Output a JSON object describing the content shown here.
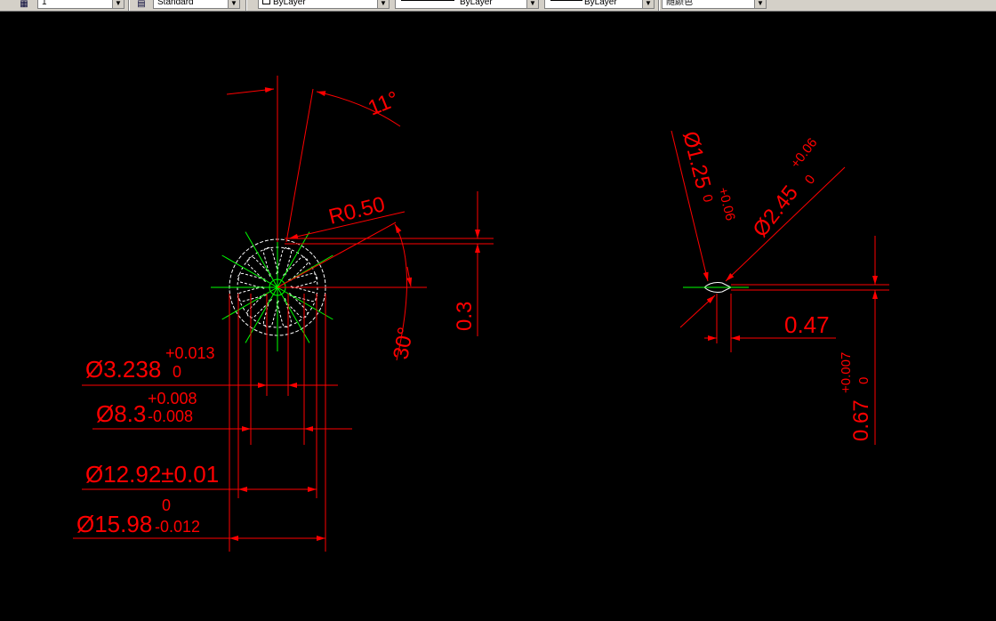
{
  "toolbar": {
    "layer_value": "1",
    "textstyle_value": "Standard",
    "color_value": "ByLayer",
    "linetype_value": "ByLayer",
    "lineweight_value": "ByLayer",
    "plotstyle_value": "随颜色",
    "icons": [
      "layer-manager-icon",
      "text-style-icon"
    ]
  },
  "colors": {
    "background": "#000000",
    "dimension": "#ff0000",
    "centerline": "#00ff00",
    "geometry": "#ffffff"
  },
  "dimensions": {
    "left": {
      "angle_top": "11°",
      "radius": "R0.50",
      "angle_right": "30°",
      "linear_right": "0.3",
      "d1_main": "Ø3.238",
      "d1_tol_upper": "+0.013",
      "d1_tol_lower": "0",
      "d2_main": "Ø8.3",
      "d2_tol_upper": "+0.008",
      "d2_tol_lower": "-0.008",
      "d3": "Ø12.92±0.01",
      "d4_main": "Ø15.98",
      "d4_tol_upper": "0",
      "d4_tol_lower": "-0.012"
    },
    "right": {
      "d_small_main": "Ø1.25",
      "d_small_tol_upper": "+0.06",
      "d_small_tol_lower": "0",
      "d_large_main": "Ø2.45",
      "d_large_tol_upper": "+0.06",
      "d_large_tol_lower": "0",
      "linear": "0.47",
      "vertical_main": "0.67",
      "vertical_tol_upper": "+0.007",
      "vertical_tol_lower": "0"
    }
  }
}
